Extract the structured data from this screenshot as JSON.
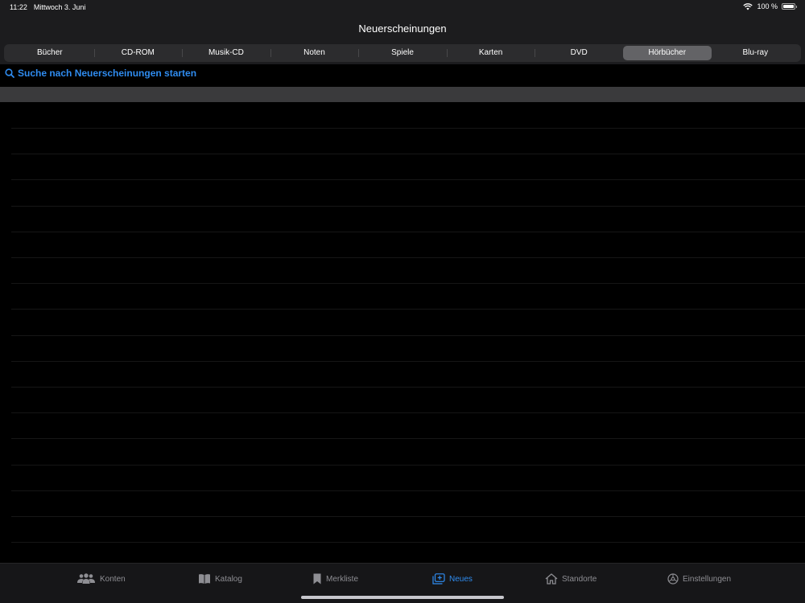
{
  "status": {
    "time": "11:22",
    "date": "Mittwoch 3. Juni",
    "battery": "100 %",
    "battery_level": 1.0
  },
  "nav": {
    "title": "Neuerscheinungen"
  },
  "segments": [
    {
      "label": "Bücher",
      "selected": false
    },
    {
      "label": "CD-ROM",
      "selected": false
    },
    {
      "label": "Musik-CD",
      "selected": false
    },
    {
      "label": "Noten",
      "selected": false
    },
    {
      "label": "Spiele",
      "selected": false
    },
    {
      "label": "Karten",
      "selected": false
    },
    {
      "label": "DVD",
      "selected": false
    },
    {
      "label": "Hörbücher",
      "selected": true
    },
    {
      "label": "Blu-ray",
      "selected": false
    }
  ],
  "search": {
    "label": "Suche nach Neuerscheinungen starten",
    "icon": "search-icon"
  },
  "tabs": [
    {
      "label": "Konten",
      "icon": "people-icon",
      "active": false
    },
    {
      "label": "Katalog",
      "icon": "book-icon",
      "active": false
    },
    {
      "label": "Merkliste",
      "icon": "bookmark-icon",
      "active": false
    },
    {
      "label": "Neues",
      "icon": "new-items-icon",
      "active": true
    },
    {
      "label": "Standorte",
      "icon": "house-icon",
      "active": false
    },
    {
      "label": "Einstellungen",
      "icon": "gear-icon",
      "active": false
    }
  ],
  "colors": {
    "accent": "#2f8cf0",
    "background": "#000000",
    "bar": "#1c1c1e",
    "selected_segment": "#636366"
  }
}
